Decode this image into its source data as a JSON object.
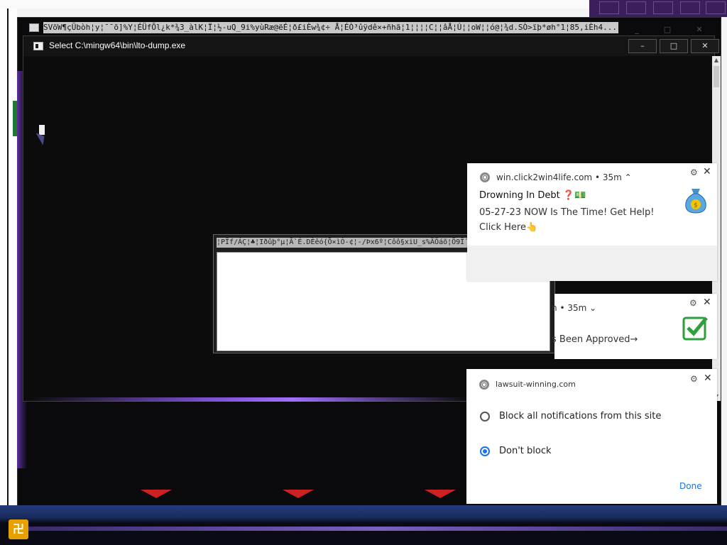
{
  "outer_window": {
    "title": "SVöW¶çÜbòh¦y¦¯¯õ]%Y¦ÉÜfÕl¿k*¾3_àlK¦Ï¦½-uQ_9i%yùRæ@ëÉ¦ð£iÈw¾¢÷ Å¦ÉÒ³ûÿdê×+ñhã¦1¦¦¦¦C¦¦âÅ¦Ú¦¦oW¦¦ó@¦¾d.SÒ>ïþ*øh°1¦85,iÈh4...",
    "minimize": "_",
    "maximize": "□",
    "close": "✕"
  },
  "console": {
    "title": "Select C:\\mingw64\\bin\\lto-dump.exe",
    "minimize_label": "–",
    "maximize_label": "□",
    "close_label": "✕",
    "scroll_up": "▲",
    "scroll_down": "▼"
  },
  "dialog": {
    "title": "¦PÏf/ÁÇ¦♣¦Iðûþ°µ¦Ã`É.DÈêó{Õ×ìÓ-¢¦-/Þx6º¦Côô§xiU_s%ÄÖáõ¦Õ9Ï`♣ïÞUWÒ...",
    "close": "✕"
  },
  "notifications": [
    {
      "origin": "win.click2win4life.com",
      "age": "35m",
      "chevron": "⌃",
      "title": "Drowning In Debt ❓💵",
      "body": "05-27-23 NOW Is The Time! Get Help! Click Here👆",
      "image_icon": "money-bag-icon",
      "settings_icon": "gear-icon",
      "close": "✕"
    },
    {
      "origin_partial": "n",
      "age": "35m",
      "chevron": "⌄",
      "body_partial": "s Been Approved→",
      "image_icon": "checkmark-icon",
      "settings_icon": "gear-icon",
      "close": "✕"
    },
    {
      "origin": "lawsuit-winning.com",
      "settings_icon": "gear-icon",
      "close": "✕",
      "options": [
        {
          "label": "Block all notifications from this site",
          "selected": false
        },
        {
          "label": "Don't block",
          "selected": true
        }
      ],
      "done_label": "Done"
    }
  ],
  "taskbar": {
    "start_glyph": "卍"
  },
  "colors": {
    "accent_blue": "#1a73e8",
    "console_bg": "#0c0c0c",
    "checkmark_green": "#2e9e3e"
  }
}
